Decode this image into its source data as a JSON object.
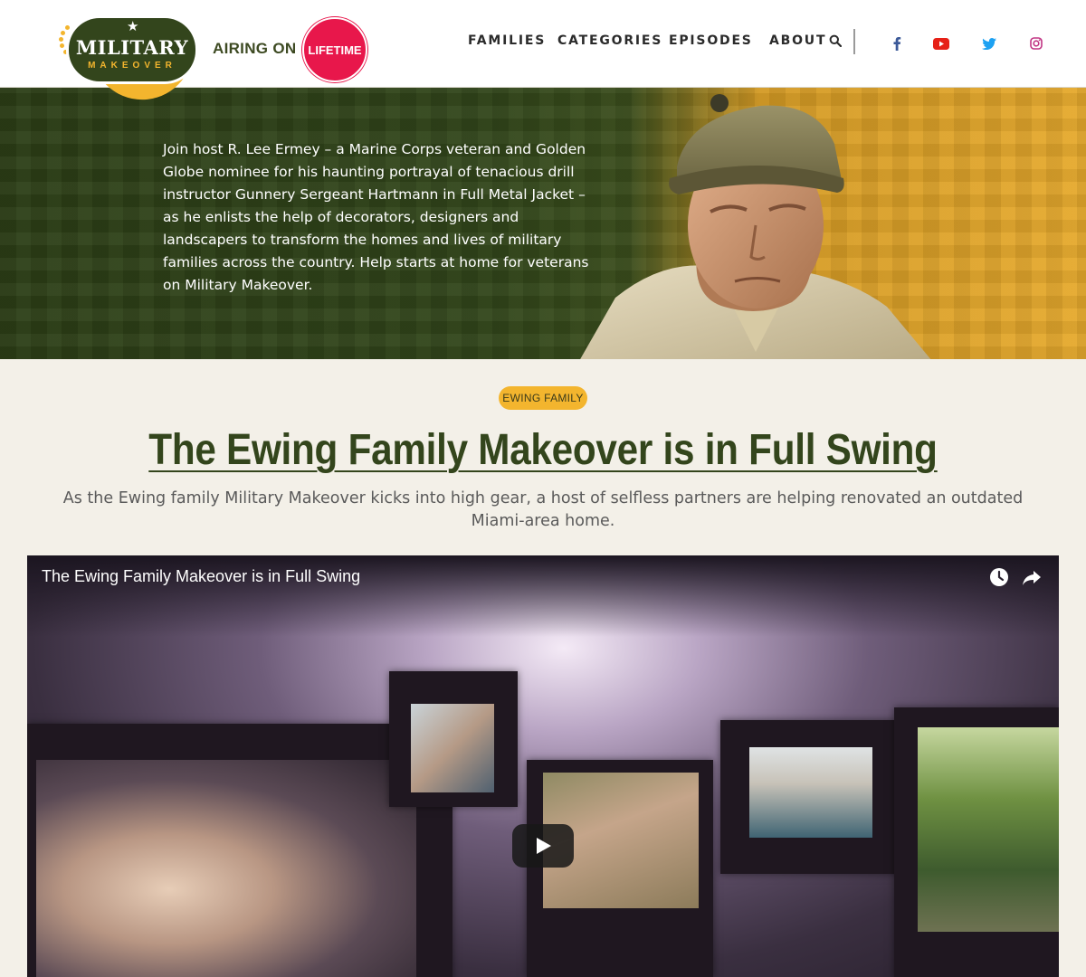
{
  "header": {
    "logo": {
      "title": "MILITARY",
      "subtitle": "MAKEOVER"
    },
    "airing_on": "AIRING ON",
    "network": "LIFETIME",
    "nav": [
      {
        "label": "FAMILIES"
      },
      {
        "label": "CATEGORIES"
      },
      {
        "label": "EPISODES"
      },
      {
        "label": "ABOUT"
      }
    ],
    "search_icon": "search-icon",
    "social": [
      "facebook-icon",
      "youtube-icon",
      "twitter-icon",
      "instagram-icon"
    ]
  },
  "hero": {
    "text": "Join host R. Lee Ermey – a Marine Corps veteran and Golden Globe nominee for his haunting portrayal of tenacious drill instructor Gunnery Sergeant Hartmann in Full Metal Jacket – as he enlists the help of decorators, designers and landscapers to transform the homes and lives of military families across the country. Help starts at home for veterans on Military Makeover."
  },
  "article": {
    "tag": "EWING FAMILY",
    "title": "The Ewing Family Makeover is in Full Swing",
    "subtitle": "As the Ewing family Military Makeover kicks into high gear, a host of selfless partners are helping renovated an outdated Miami-area home."
  },
  "video": {
    "title": "The Ewing Family Makeover is in Full Swing",
    "icons": [
      "clock-icon",
      "share-icon",
      "play-icon"
    ]
  },
  "colors": {
    "brand_green": "#33451c",
    "brand_gold": "#f3b52e",
    "lifetime_red": "#e8174b",
    "page_bg": "#f3f0e8"
  }
}
